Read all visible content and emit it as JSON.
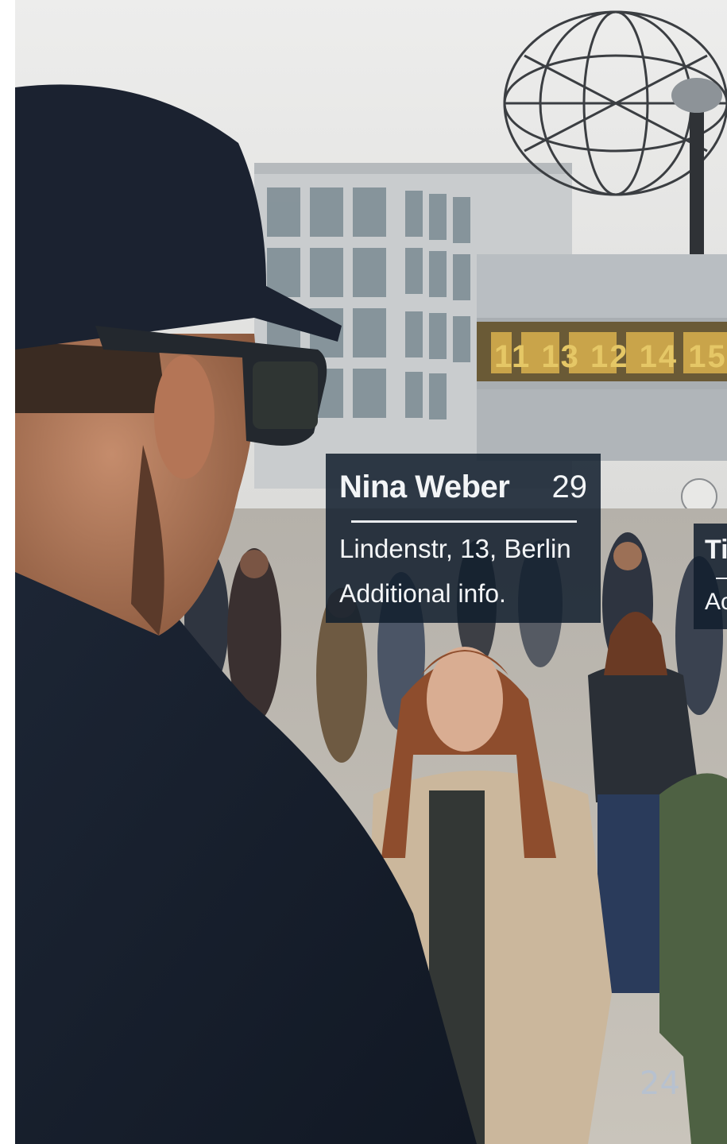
{
  "overlay_primary": {
    "name": "Nina Weber",
    "age": "29",
    "address": "Lindenstr, 13, Berlin",
    "info": "Additional info."
  },
  "overlay_secondary": {
    "name_fragment": "Ti",
    "info_fragment": "Ac"
  },
  "world_clock_numbers": "11  13  12  14  15",
  "page_number": "24",
  "colors": {
    "overlay_bg": "#121e2d",
    "overlay_text": "#f3f5f7",
    "page_number": "#b7c1cf"
  }
}
